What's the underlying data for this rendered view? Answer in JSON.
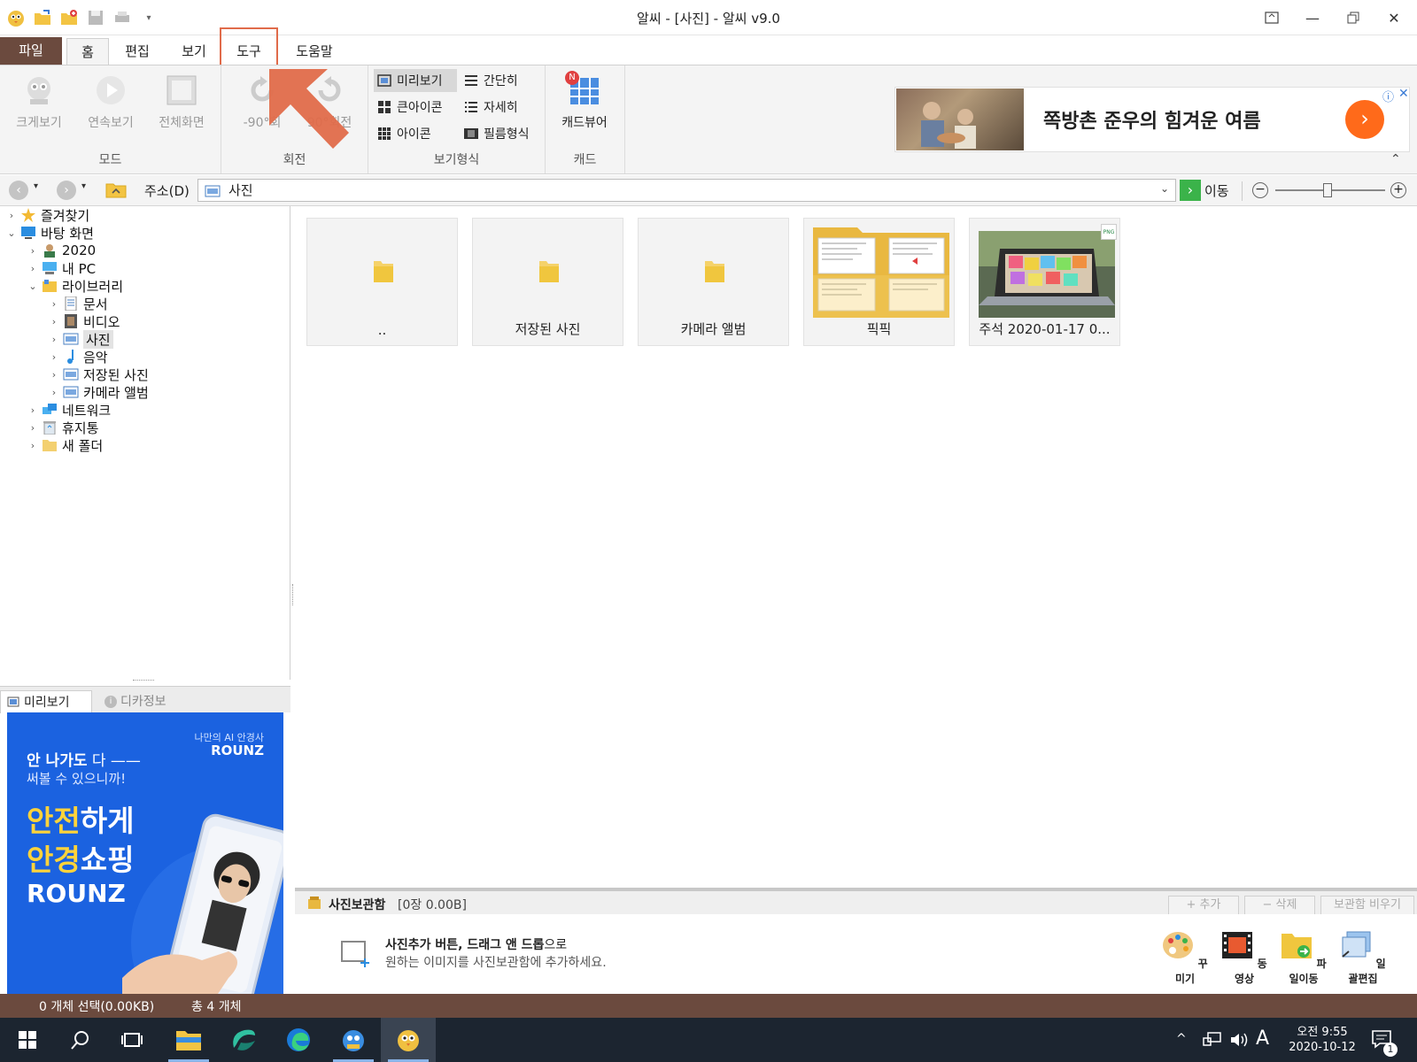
{
  "window": {
    "title": "알씨 - [사진] - 알씨 v9.0"
  },
  "tabs": {
    "file": "파일",
    "home": "홈",
    "edit": "편집",
    "view": "보기",
    "tools": "도구",
    "help": "도움말"
  },
  "ribbon": {
    "mode": {
      "label": "모드",
      "large_view": "크게보기",
      "slideshow": "연속보기",
      "fullscreen": "전체화면"
    },
    "rotate": {
      "label": "회전",
      "left": "-90°회",
      "right": "90°회전"
    },
    "view_format": {
      "label": "보기형식",
      "preview": "미리보기",
      "simple": "간단히",
      "large_icon": "큰아이콘",
      "details": "자세히",
      "icon": "아이콘",
      "filmstrip": "필름형식"
    },
    "card": {
      "label": "캐드",
      "cad_viewer": "캐드뷰어",
      "badge": "N"
    },
    "ad": {
      "text": "쪽방촌 준우의 힘겨운 여름"
    }
  },
  "address": {
    "label": "주소(D)",
    "value": "사진",
    "go": "이동"
  },
  "tree": [
    {
      "label": "즐겨찾기"
    },
    {
      "label": "바탕 화면"
    },
    {
      "label": "2020"
    },
    {
      "label": "내 PC"
    },
    {
      "label": "라이브러리"
    },
    {
      "label": "문서"
    },
    {
      "label": "비디오"
    },
    {
      "label": "사진"
    },
    {
      "label": "음악"
    },
    {
      "label": "저장된 사진"
    },
    {
      "label": "카메라 앨범"
    },
    {
      "label": "네트워크"
    },
    {
      "label": "휴지통"
    },
    {
      "label": "새 폴더"
    }
  ],
  "preview_panel": {
    "tab_preview": "미리보기",
    "tab_camera_info": "디카정보",
    "ad": {
      "brand_tag": "나만의 AI 안경사",
      "brand": "ROUNZ",
      "line1_bold": "안 나가도",
      "line1_rest": " 다 ——",
      "line2": "써볼 수 있으니까!",
      "head1_hl": "안전",
      "head1_rest": "하게",
      "head2_hl": "안경",
      "head2_rest": "쇼핑",
      "head3": "ROUNZ"
    }
  },
  "files": [
    {
      "name": ".."
    },
    {
      "name": "저장된 사진"
    },
    {
      "name": "카메라 앨범"
    },
    {
      "name": "픽픽"
    },
    {
      "name": "주석 2020-01-17 0..."
    }
  ],
  "png_badge": "PNG",
  "photo_box": {
    "title": "사진보관함",
    "info": "[0장 0.00B]",
    "add": "+ 추가",
    "delete": "− 삭제",
    "empty": "보관함 비우기",
    "hint_bold": "사진추가 버튼, 드래그 앤 드롭",
    "hint_rest": "으로",
    "hint_line2": "원하는 이미지를 사진보관함에 추가하세요.",
    "tools": [
      "꾸미기",
      "동영상",
      "파일이동",
      "일괄편집"
    ]
  },
  "status": {
    "selected": "0 개체 선택(0.00KB)",
    "total": "총 4 개체"
  },
  "taskbar": {
    "time": "오전 9:55",
    "date": "2020-10-12",
    "ime": "A",
    "notif_count": "1"
  },
  "colors": {
    "accent_brown": "#6b4a3e",
    "highlight": "#e06b4a",
    "go_green": "#3bb34a",
    "ad_blue": "#1b62e0"
  }
}
